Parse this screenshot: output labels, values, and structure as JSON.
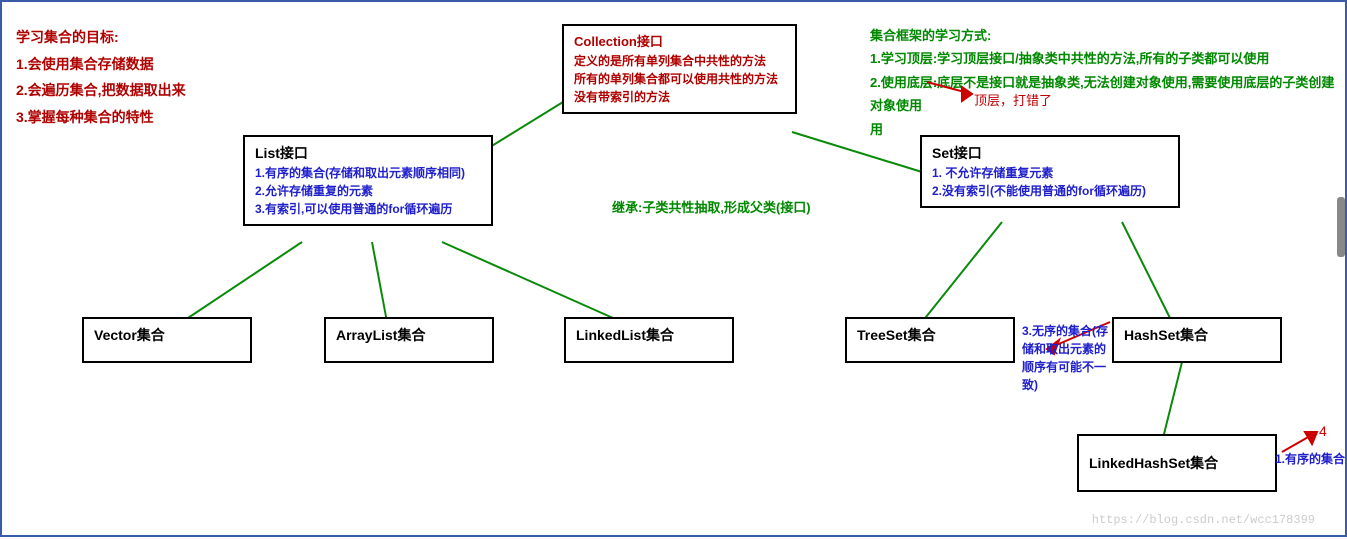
{
  "goals": {
    "title": "学习集合的目标:",
    "l1": "1.会使用集合存储数据",
    "l2": "2.会遍历集合,把数据取出来",
    "l3": "3.掌握每种集合的特性"
  },
  "study": {
    "title": "集合框架的学习方式:",
    "l1": "1.学习顶层:学习顶层接口/抽象类中共性的方法,所有的子类都可以使用",
    "l2": "2.使用底层:底层不是接口就是抽象类,无法创建对象使用,需要使用底层的子类创建对象使用",
    "l3": "用"
  },
  "collection": {
    "title": "Collection接口",
    "l1": "定义的是所有单列集合中共性的方法",
    "l2": "所有的单列集合都可以使用共性的方法",
    "l3": "没有带索引的方法"
  },
  "list": {
    "title": "List接口",
    "l1": "1.有序的集合(存储和取出元素顺序相同)",
    "l2": "2.允许存储重复的元素",
    "l3": "3.有索引,可以使用普通的for循环遍历"
  },
  "set": {
    "title": "Set接口",
    "l1": "1. 不允许存储重复元素",
    "l2": "2.没有索引(不能使用普通的for循环遍历)"
  },
  "vector": "Vector集合",
  "arraylist": "ArrayList集合",
  "linkedlist": "LinkedList集合",
  "treeset": "TreeSet集合",
  "hashset": "HashSet集合",
  "linkedhashset": "LinkedHashSet集合",
  "inherit": "继承:子类共性抽取,形成父类(接口)",
  "anno_top": "顶层，打错了",
  "anno_hash": "3.无序的集合(存储和取出元素的顺序有可能不一致)",
  "anno_linked": "1.有序的集合",
  "num4": "4",
  "watermark": "https://blog.csdn.net/wcc178399"
}
